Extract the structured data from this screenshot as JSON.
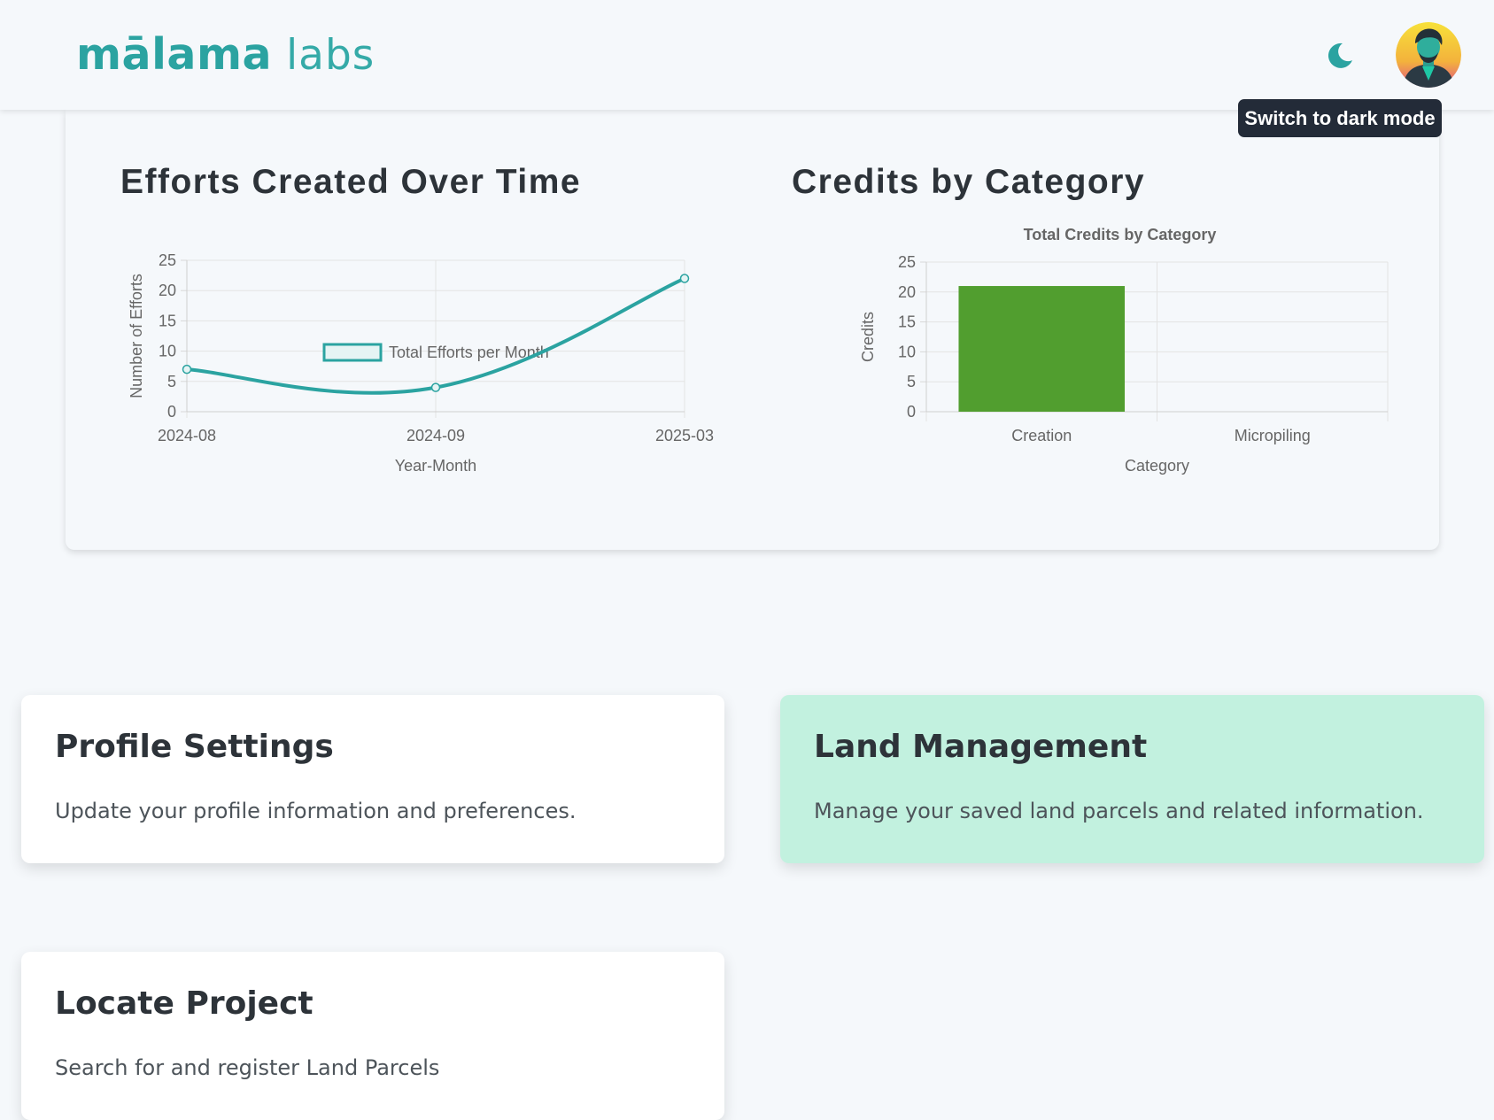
{
  "header": {
    "logo_bold": "mālama",
    "logo_light": "labs",
    "theme_tooltip": "Switch to dark mode"
  },
  "colors": {
    "accent": "#2ba3a1",
    "bar": "#519e2f",
    "highlight_card": "#c2f1df",
    "tooltip_bg": "#232b38"
  },
  "charts": {
    "efforts_title": "Efforts Created Over Time",
    "credits_title": "Credits by Category"
  },
  "chart_data": [
    {
      "type": "line",
      "title": "",
      "legend": [
        "Total Efforts per Month"
      ],
      "xlabel": "Year-Month",
      "ylabel": "Number of Efforts",
      "categories": [
        "2024-08",
        "2024-09",
        "2025-03"
      ],
      "series": [
        {
          "name": "Total Efforts per Month",
          "values": [
            7,
            4,
            22
          ]
        }
      ],
      "ylim": [
        0,
        25
      ],
      "yticks": [
        0,
        5,
        10,
        15,
        20,
        25
      ],
      "grid": true,
      "legend_position": "top"
    },
    {
      "type": "bar",
      "title": "Total Credits by Category",
      "xlabel": "Category",
      "ylabel": "Credits",
      "categories": [
        "Creation",
        "Micropiling"
      ],
      "values": [
        21,
        0
      ],
      "ylim": [
        0,
        25
      ],
      "yticks": [
        0,
        5,
        10,
        15,
        20,
        25
      ],
      "grid": true
    }
  ],
  "cards": {
    "profile": {
      "title": "Profile Settings",
      "desc": "Update your profile information and preferences."
    },
    "land": {
      "title": "Land Management",
      "desc": "Manage your saved land parcels and related information."
    },
    "locate": {
      "title": "Locate Project",
      "desc": "Search for and register Land Parcels"
    }
  }
}
